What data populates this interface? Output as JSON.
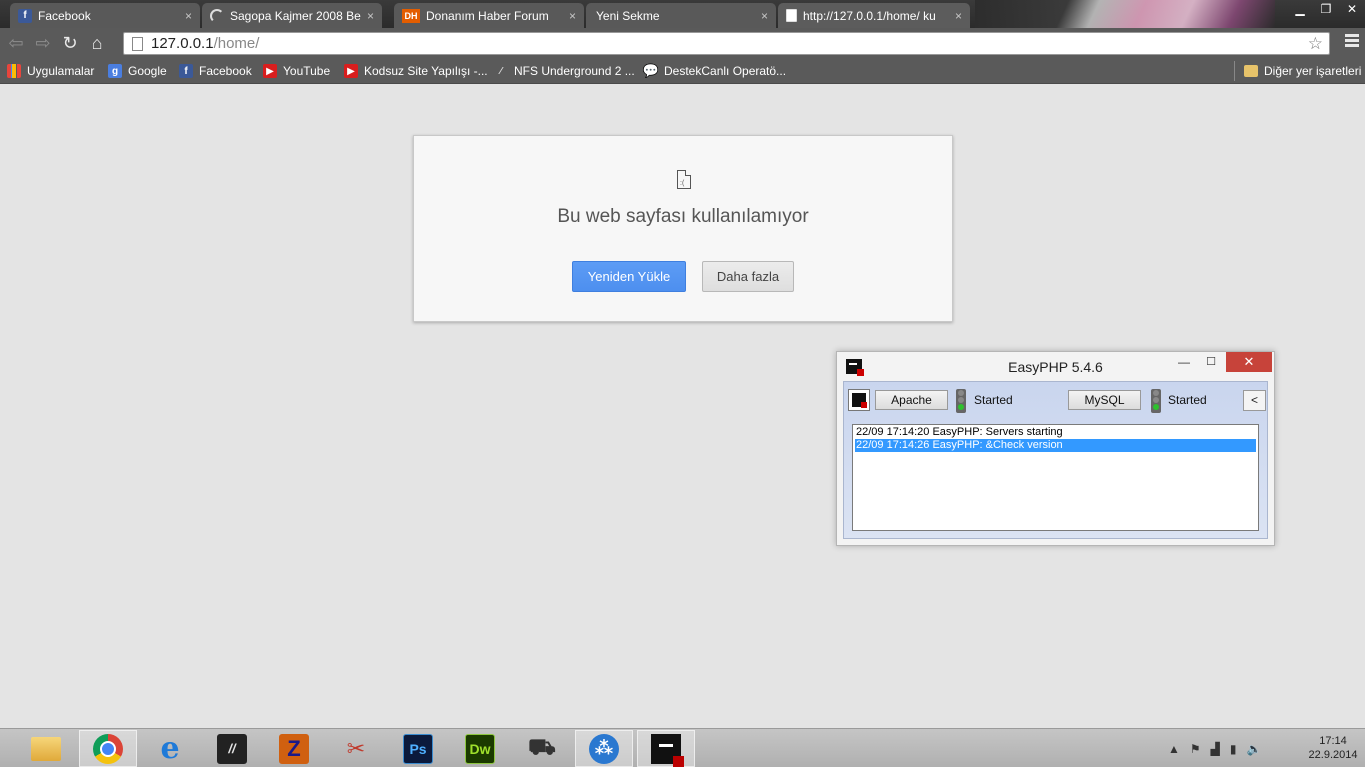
{
  "browser": {
    "tabs": [
      {
        "title": "Facebook",
        "icon": "facebook-icon"
      },
      {
        "title": "Sagopa Kajmer 2008 Be",
        "icon": "loading-spinner-icon"
      },
      {
        "title": "Donanım Haber Forum",
        "icon": "donanimhaber-icon",
        "icon_text": "DH"
      },
      {
        "title": "Yeni Sekme",
        "icon": ""
      },
      {
        "title": "http://127.0.0.1/home/ ku",
        "icon": "page-icon",
        "active": true
      }
    ],
    "tab_close_glyph": "×",
    "address": {
      "host": "127.0.0.1",
      "path": "/home/"
    },
    "bookmarks": [
      {
        "label": "Uygulamalar",
        "icon": "apps-icon"
      },
      {
        "label": "Google",
        "icon": "google-icon",
        "icon_text": "g"
      },
      {
        "label": "Facebook",
        "icon": "facebook-icon",
        "icon_text": "f"
      },
      {
        "label": "YouTube",
        "icon": "youtube-icon",
        "icon_text": "▶"
      },
      {
        "label": "Kodsuz Site Yapılışı -...",
        "icon": "youtube-icon",
        "icon_text": "▶"
      },
      {
        "label": "NFS Underground 2 ...",
        "icon": "nfs-icon",
        "icon_text": "⁄"
      },
      {
        "label": "DestekCanlı Operatö...",
        "icon": "chat-icon",
        "icon_text": "💬"
      }
    ],
    "other_bookmarks": "Diğer yer işaretleri"
  },
  "error_page": {
    "title": "Bu web sayfası kullanılamıyor",
    "reload_label": "Yeniden Yükle",
    "more_label": "Daha fazla"
  },
  "easyphp": {
    "title": "EasyPHP 5.4.6",
    "apache_label": "Apache",
    "apache_status": "Started",
    "mysql_label": "MySQL",
    "mysql_status": "Started",
    "collapse_label": "<",
    "log": [
      {
        "text": "22/09 17:14:20 EasyPHP: Servers starting",
        "selected": false
      },
      {
        "text": "22/09 17:14:26 EasyPHP: &Check version",
        "selected": true
      }
    ]
  },
  "taskbar": {
    "apps": [
      {
        "name": "file-explorer-icon",
        "open": false
      },
      {
        "name": "chrome-icon",
        "open": true
      },
      {
        "name": "internet-explorer-icon",
        "open": false
      },
      {
        "name": "app-icon",
        "open": false
      },
      {
        "name": "filezilla-icon",
        "open": false
      },
      {
        "name": "snipping-tool-icon",
        "open": false
      },
      {
        "name": "photoshop-icon",
        "open": false,
        "text": "Ps"
      },
      {
        "name": "dreamweaver-icon",
        "open": false,
        "text": "Dw"
      },
      {
        "name": "truck-game-icon",
        "open": false
      },
      {
        "name": "blue-app-icon",
        "open": true
      },
      {
        "name": "easyphp-icon",
        "open": true
      }
    ],
    "time": "17:14",
    "date": "22.9.2014"
  },
  "colors": {
    "accent": "#4d8fef",
    "close_red": "#c7433a",
    "selection": "#3399ff"
  }
}
